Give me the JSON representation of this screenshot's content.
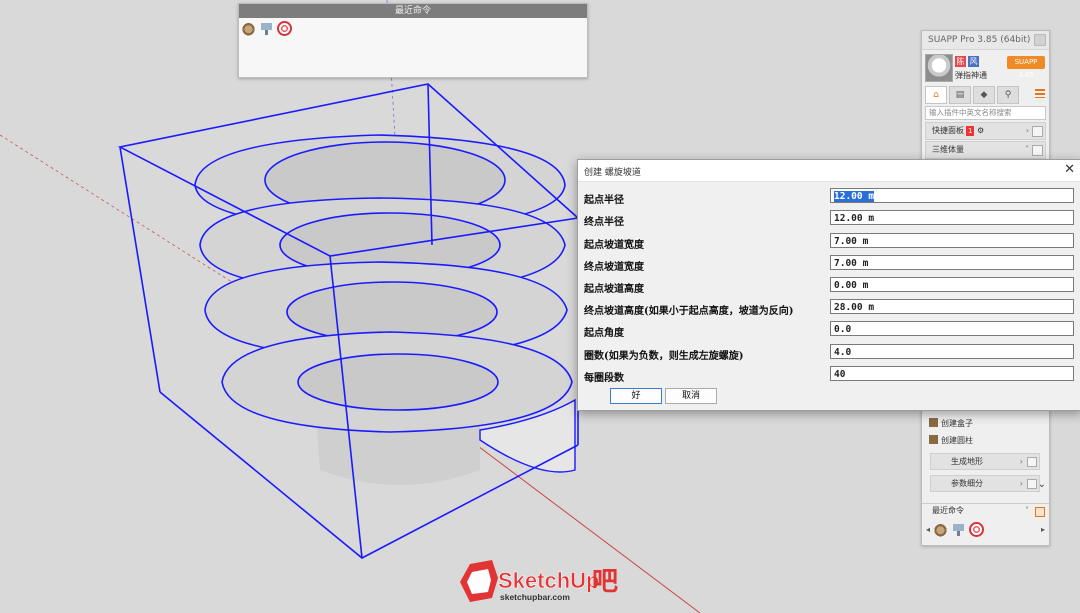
{
  "recent_panel": {
    "title": "最近命令"
  },
  "suapp": {
    "title": "SUAPP Pro 3.85 (64bit)",
    "user_badge_red": "陈",
    "user_badge_blue": "风",
    "username": "弹指神通",
    "version_button": "SUAPP 3.85",
    "search_placeholder": "输入插件中英文名称搜索",
    "quick_panel": "快捷面板",
    "quick_panel_count": "1",
    "category": "三维体量",
    "items": [
      "创建盒子",
      "创建圆柱"
    ],
    "row_terrain": "生成地形",
    "row_subdivide": "参数细分",
    "recent_commands": "最近命令"
  },
  "dialog": {
    "title": "创建 螺旋坡道",
    "fields": [
      {
        "label": "起点半径",
        "value": "12.00 m"
      },
      {
        "label": "终点半径",
        "value": "12.00 m"
      },
      {
        "label": "起点坡道宽度",
        "value": "7.00 m"
      },
      {
        "label": "终点坡道宽度",
        "value": "7.00 m"
      },
      {
        "label": "起点坡道高度",
        "value": "0.00 m"
      },
      {
        "label": "终点坡道高度(如果小于起点高度，坡道为反向)",
        "value": "28.00 m"
      },
      {
        "label": "起点角度",
        "value": "0.0"
      },
      {
        "label": "圈数(如果为负数，则生成左旋螺旋)",
        "value": "4.0"
      },
      {
        "label": "每圈段数",
        "value": "40"
      }
    ],
    "ok_label": "好",
    "cancel_label": "取消"
  },
  "logo": {
    "brand": "SketchUp",
    "suffix": "吧",
    "url": "sketchupbar.com"
  },
  "colors": {
    "wire": "#1a1aff",
    "accent": "#f08a24",
    "selection": "#2a6fd6"
  }
}
